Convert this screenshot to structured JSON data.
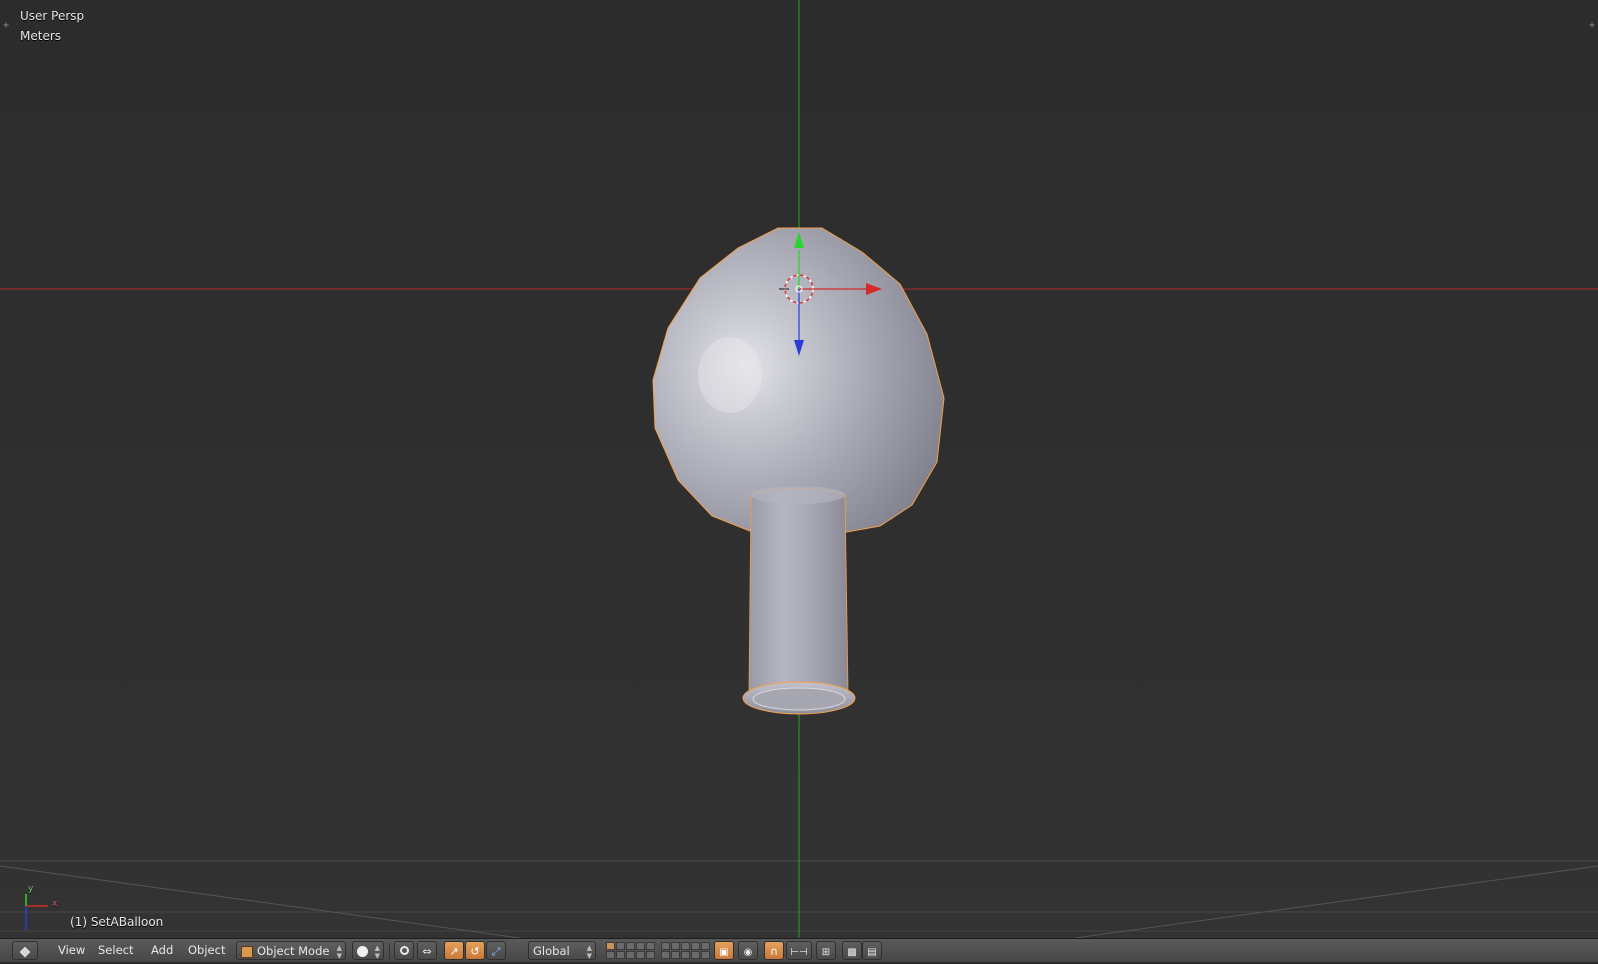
{
  "viewport": {
    "view_name": "User Persp",
    "units": "Meters",
    "object_info": "(1) SetABalloon",
    "mini_axis": {
      "y_label": "y",
      "x_label": "x"
    }
  },
  "colors": {
    "background": "#2e2e2e",
    "x_axis": "#cc2e2e",
    "y_axis": "#2ecc2e",
    "z_axis": "#2e3ccc",
    "selection_outline": "#f2a04a",
    "toolbar": "#4f4f4f"
  },
  "header": {
    "editor_type_icon": "cube-icon",
    "menus": [
      "View",
      "Select",
      "Add",
      "Object"
    ],
    "mode": {
      "icon": "object-mode-icon",
      "label": "Object Mode"
    },
    "shading_icon": "solid-sphere-icon",
    "pivot_icon": "pivot-point-icon",
    "manipulator_icons": [
      "manipulator-toggle-icon",
      "translate-icon",
      "rotate-icon",
      "scale-icon"
    ],
    "orientation": "Global",
    "layers_active": [
      1
    ],
    "extra_icons": [
      "lock-layers-icon",
      "proportional-edit-icon",
      "snap-magnet-icon",
      "snap-element-icon",
      "snap-target-icon",
      "render-camera-icon",
      "render-anim-icon"
    ]
  }
}
